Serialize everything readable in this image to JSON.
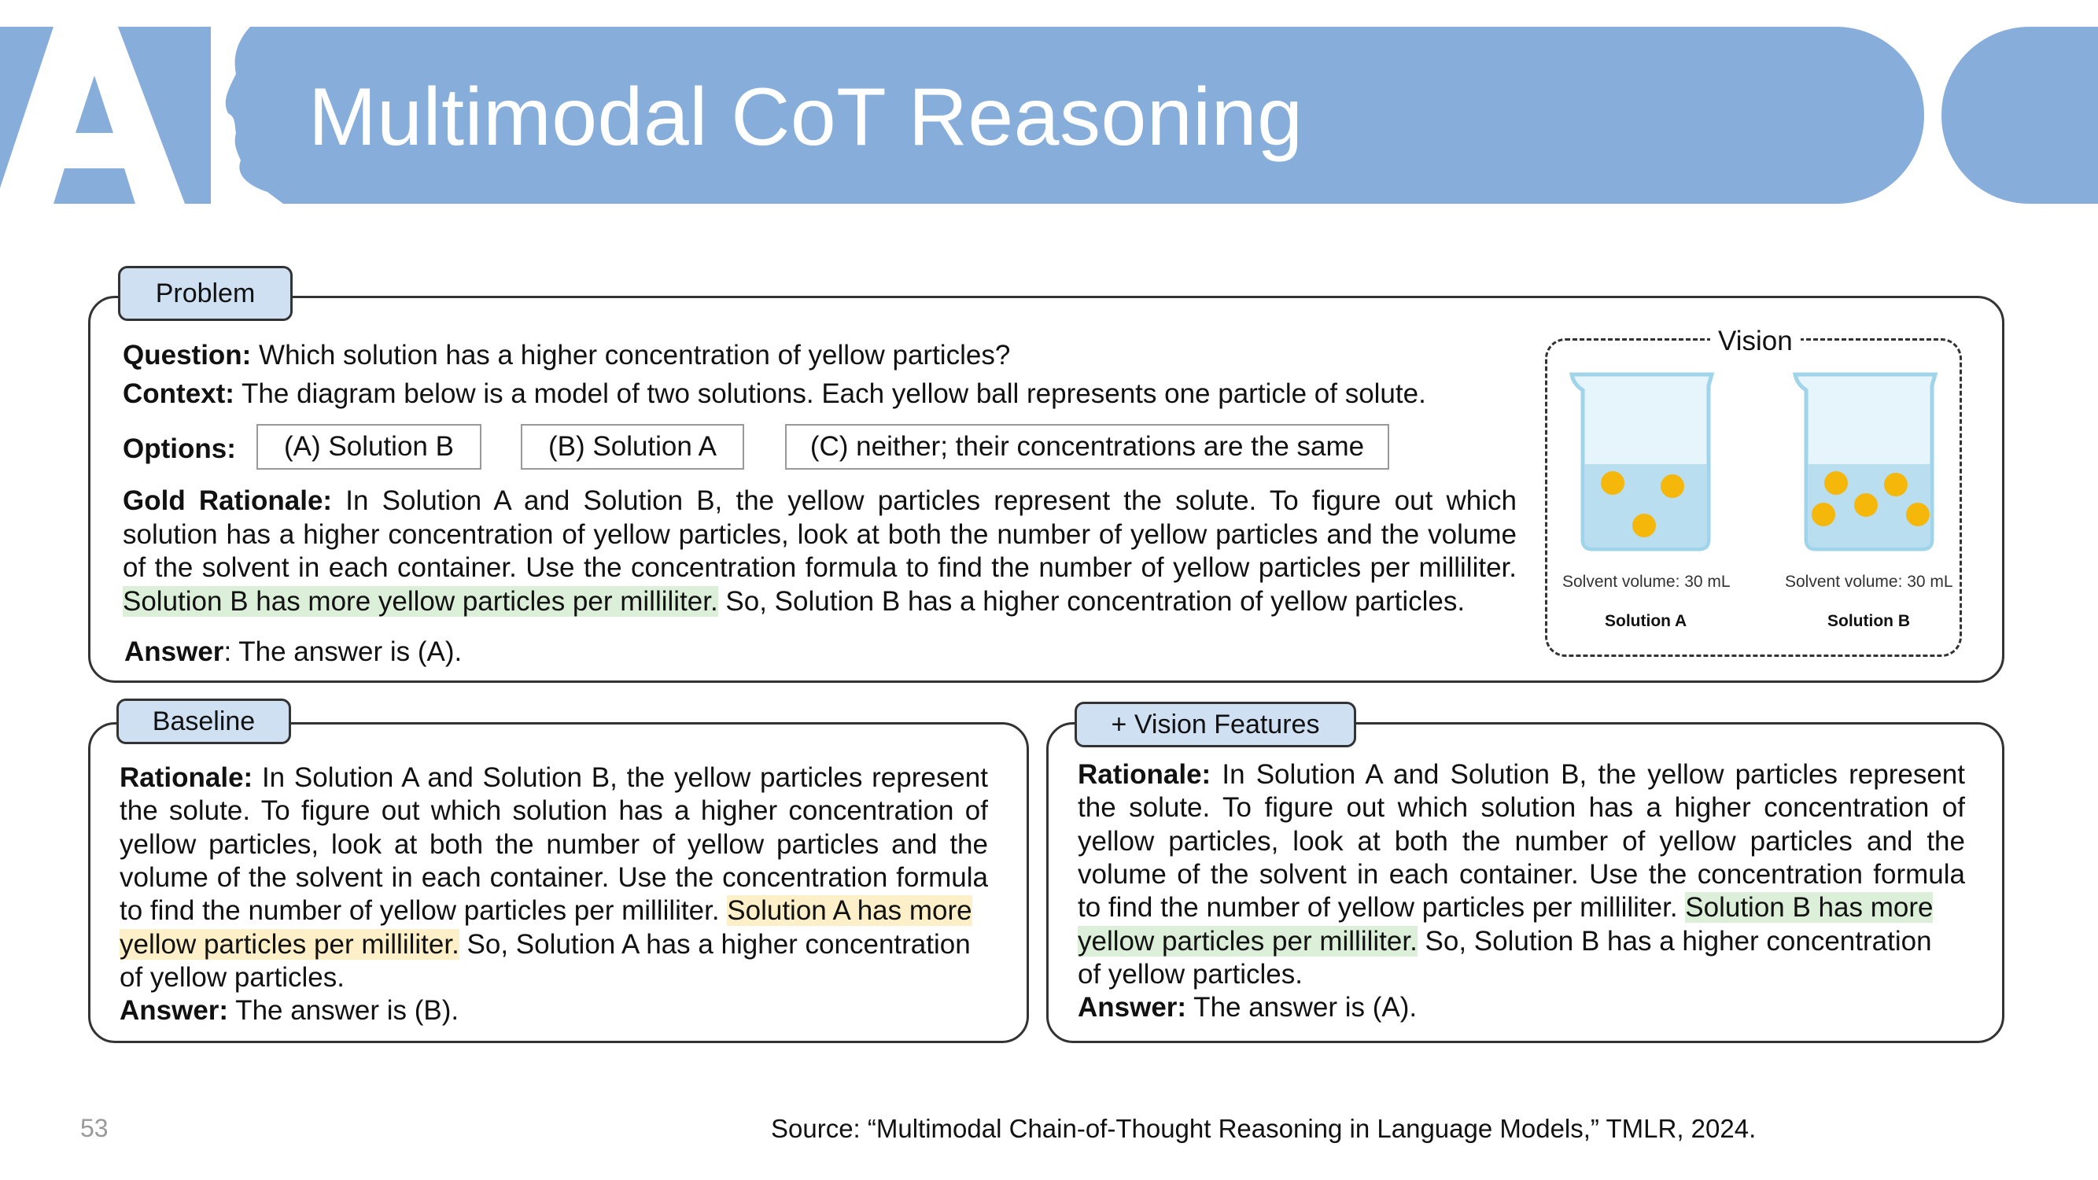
{
  "header": {
    "title": "Multimodal CoT Reasoning"
  },
  "colors": {
    "banner": "#87aedb",
    "tag": "#cfe0f3",
    "green_highlight": "#dcefd8",
    "yellow_highlight": "#fdf0c8",
    "particle": "#f5b70a"
  },
  "problem": {
    "tag": "Problem",
    "question_label": "Question:",
    "question_text": " Which solution has a higher concentration of yellow particles?",
    "context_label": "Context:",
    "context_text": " The diagram below is a model of two solutions. Each yellow ball represents one particle of solute.",
    "options_label": "Options:",
    "options": [
      "(A) Solution B",
      "(B) Solution A",
      "(C) neither; their concentrations are the same"
    ],
    "gold_label": "Gold Rationale:",
    "gold_text": " In Solution A and Solution B, the yellow particles represent the solute. To figure out which solution has a higher concentration of yellow particles, look at both the number of yellow particles and the volume of the solvent in each container. Use the concentration formula to find the number of yellow particles per milliliter.",
    "gold_highlight": "Solution B has more yellow particles per milliliter.",
    "gold_tail": " So, Solution B has a higher concentration of yellow particles.",
    "answer_label": "Answer",
    "answer_text": ":  The answer is (A).",
    "vision": {
      "label": "Vision",
      "beakers": [
        {
          "caption": "Solvent volume: 30 mL",
          "name": "Solution A",
          "particles": 3
        },
        {
          "caption": "Solvent volume: 30 mL",
          "name": "Solution B",
          "particles": 5
        }
      ]
    }
  },
  "baseline": {
    "tag": "Baseline",
    "rationale_label": "Rationale:",
    "line1": " In Solution A and Solution B, the yellow particles represent",
    "line2": "the solute. To figure out which solution has a higher concentration of",
    "line3": "yellow particles, look at both the number of yellow particles and the",
    "line4": "volume of the solvent in each container. Use the concentration formula",
    "line5_pre": "to find the number of yellow particles per milliliter. ",
    "line5_hl": "Solution A has more",
    "line6_hl": "yellow particles per milliliter.",
    "line6_post": " So, Solution A has a higher concentration",
    "line7": "of yellow particles.",
    "answer_label": "Answer:",
    "answer_text": "  The answer is (B)."
  },
  "vision_features": {
    "tag": "+ Vision Features",
    "rationale_label": "Rationale:",
    "line1": "  In Solution A and Solution B, the yellow particles represent",
    "line2": "the solute. To figure out which solution has a higher concentration of",
    "line3": "yellow particles, look at both the number of yellow particles and the",
    "line4": "volume of the solvent in each container. Use the concentration formula",
    "line5_pre": "to find the number of yellow particles per milliliter. ",
    "line5_hl": "Solution B has more",
    "line6_hl": "yellow particles per milliliter.",
    "line6_post": " So, Solution B has a higher concentration",
    "line7": "of yellow particles.",
    "answer_label": "Answer:",
    "answer_text": "  The answer is (A)."
  },
  "footer": {
    "page_number": "53",
    "source": "Source: “Multimodal Chain-of-Thought Reasoning in Language Models,” TMLR, 2024."
  }
}
